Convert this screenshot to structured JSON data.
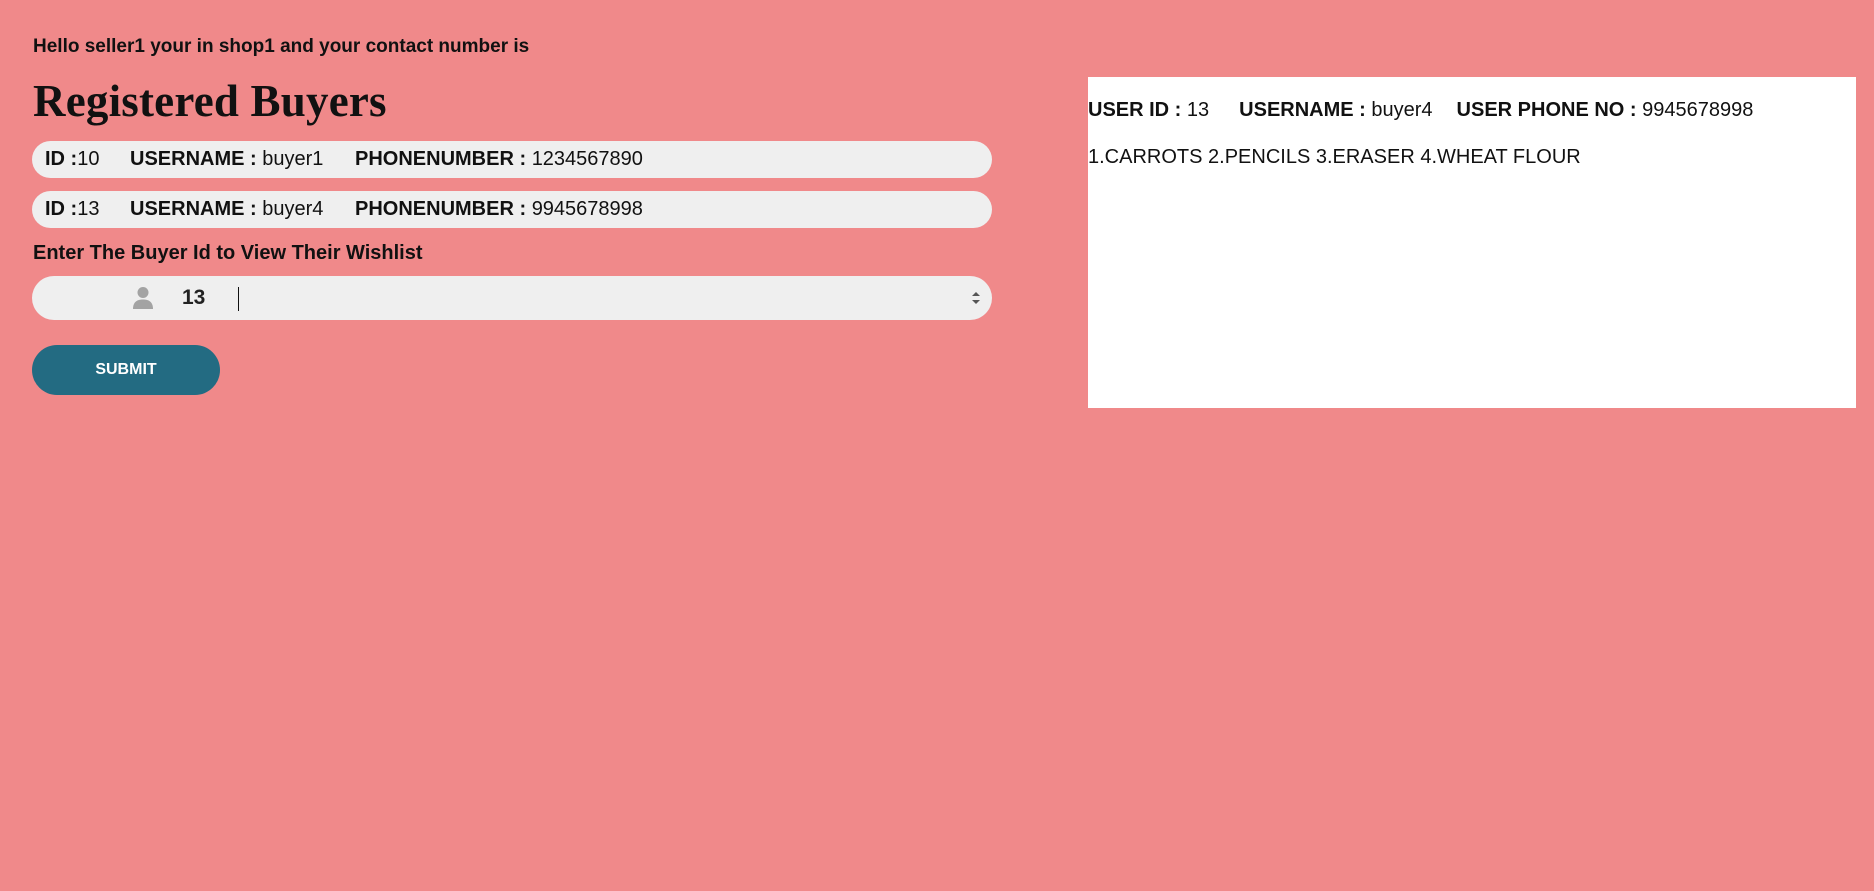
{
  "greeting": "Hello seller1 your in shop1 and your contact number is",
  "title": "Registered Buyers",
  "buyers": [
    {
      "id_label": "ID :",
      "id": "10",
      "username_label": "USERNAME :",
      "username": "buyer1",
      "phone_label": "PHONENUMBER :",
      "phone": "1234567890"
    },
    {
      "id_label": "ID :",
      "id": "13",
      "username_label": "USERNAME :",
      "username": "buyer4",
      "phone_label": "PHONENUMBER :",
      "phone": "9945678998"
    }
  ],
  "form": {
    "prompt": "Enter The Buyer Id to View Their Wishlist",
    "input_value": "13",
    "submit_label": "SUBMIT",
    "user_icon": "user-icon"
  },
  "wishlist": {
    "user_id_label": "USER ID :",
    "user_id": "13",
    "username_label": "USERNAME :",
    "username": "buyer4",
    "phone_label": "USER PHONE NO :",
    "phone": "9945678998",
    "items_text": "1.CARROTS 2.PENCILS 3.ERASER 4.WHEAT FLOUR"
  },
  "colors": {
    "background": "#f0898a",
    "row_background": "#efefef",
    "button": "#236b82",
    "panel": "#ffffff"
  }
}
